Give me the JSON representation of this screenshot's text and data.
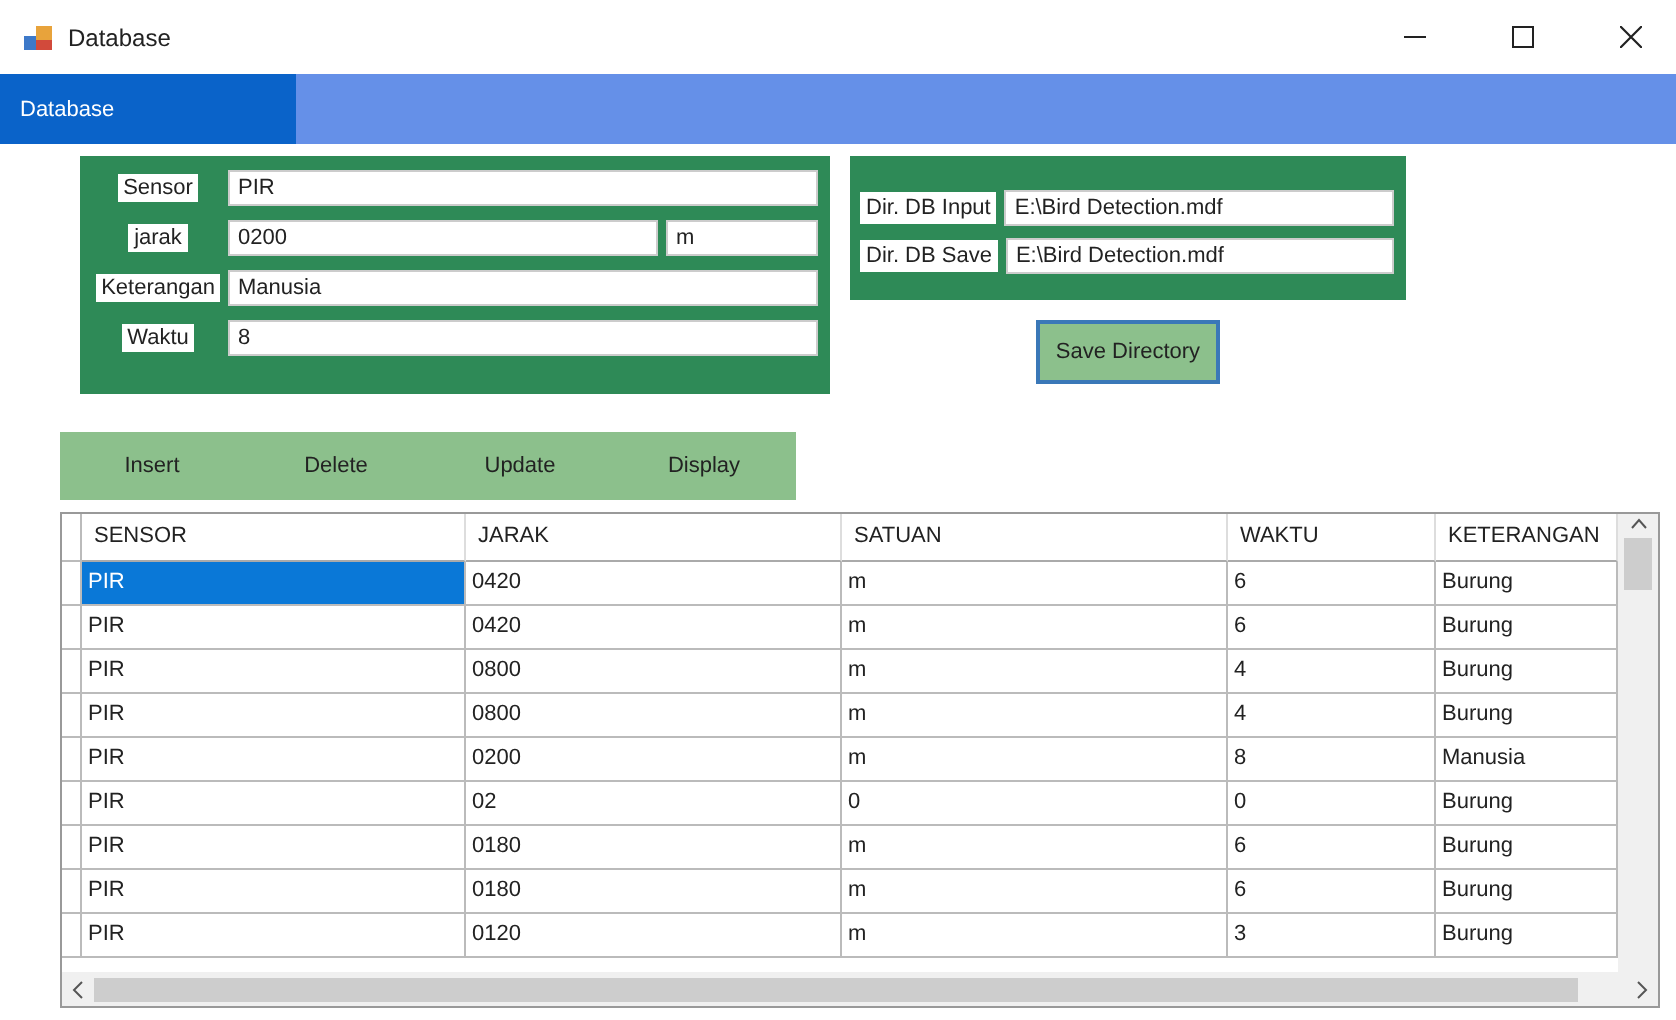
{
  "window": {
    "title": "Database"
  },
  "menu": {
    "tabs": [
      {
        "label": "Database",
        "selected": true
      }
    ]
  },
  "sensor_form": {
    "fields": [
      {
        "label": "Sensor",
        "value": "PIR"
      },
      {
        "label": "jarak",
        "value": "0200",
        "unit": "m"
      },
      {
        "label": "Keterangan",
        "value": "Manusia"
      },
      {
        "label": "Waktu",
        "value": "8"
      }
    ]
  },
  "directory_form": {
    "fields": [
      {
        "label": "Dir. DB Input",
        "value": "E:\\Bird Detection.mdf"
      },
      {
        "label": "Dir. DB Save",
        "value": "E:\\Bird Detection.mdf"
      }
    ],
    "save_button": "Save Directory"
  },
  "actions": [
    "Insert",
    "Delete",
    "Update",
    "Display"
  ],
  "table": {
    "columns": [
      "SENSOR",
      "JARAK",
      "SATUAN",
      "WAKTU",
      "KETERANGAN"
    ],
    "rows": [
      {
        "cells": [
          "PIR",
          "0420",
          "m",
          "6",
          "Burung"
        ],
        "selected": true
      },
      {
        "cells": [
          "PIR",
          "0420",
          "m",
          "6",
          "Burung"
        ],
        "selected": false
      },
      {
        "cells": [
          "PIR",
          "0800",
          "m",
          "4",
          "Burung"
        ],
        "selected": false
      },
      {
        "cells": [
          "PIR",
          "0800",
          "m",
          "4",
          "Burung"
        ],
        "selected": false
      },
      {
        "cells": [
          "PIR",
          "0200",
          "m",
          "8",
          "Manusia"
        ],
        "selected": false
      },
      {
        "cells": [
          "PIR",
          "02",
          "0",
          "0",
          "Burung"
        ],
        "selected": false
      },
      {
        "cells": [
          "PIR",
          "0180",
          "m",
          "6",
          "Burung"
        ],
        "selected": false
      },
      {
        "cells": [
          "PIR",
          "0180",
          "m",
          "6",
          "Burung"
        ],
        "selected": false
      },
      {
        "cells": [
          "PIR",
          "0120",
          "m",
          "3",
          "Burung"
        ],
        "selected": false
      }
    ]
  }
}
